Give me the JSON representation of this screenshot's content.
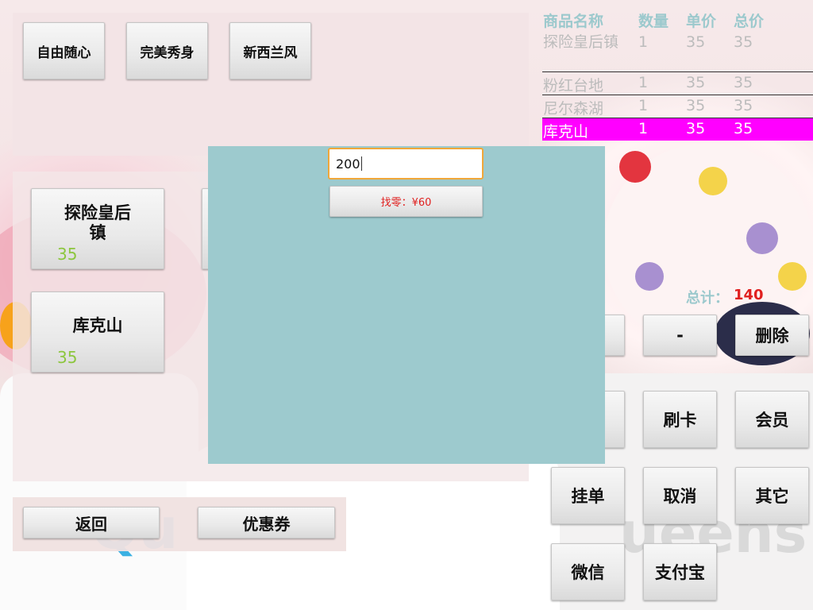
{
  "categories": [
    "自由随心",
    "完美秀身",
    "新西兰风"
  ],
  "products": [
    {
      "name": "探险皇后\n镇",
      "price": "35"
    },
    {
      "name": "库克山",
      "price": "35"
    }
  ],
  "bottom_buttons": {
    "back": "返回",
    "coupon": "优惠券"
  },
  "order": {
    "headers": {
      "name": "商品名称",
      "qty": "数量",
      "unit": "单价",
      "total": "总价"
    },
    "rows": [
      {
        "name": "探险皇后镇",
        "qty": "1",
        "unit": "35",
        "total": "35"
      },
      {
        "name": "粉红台地",
        "qty": "1",
        "unit": "35",
        "total": "35"
      },
      {
        "name": "尼尔森湖",
        "qty": "1",
        "unit": "35",
        "total": "35"
      },
      {
        "name": "库克山",
        "qty": "1",
        "unit": "35",
        "total": "35",
        "selected": true
      }
    ],
    "total_label": "总计：",
    "total_value": "140"
  },
  "actions": {
    "minus": "-",
    "delete": "删除",
    "card": "刷卡",
    "member": "会员",
    "hold": "挂单",
    "cancel": "取消",
    "other": "其它",
    "wechat": "微信",
    "alipay": "支付宝"
  },
  "dialog": {
    "cash_value": "200",
    "change_label": "找零：¥60"
  },
  "background": {
    "brand_left": "Qu",
    "brand_right": "ueens"
  },
  "colors": {
    "selected_row": "#ff00ff",
    "price_green": "#8cc63e",
    "total_red": "#e0201f",
    "header_teal": "#9cc9cd",
    "dialog_bg": "#9dcace",
    "input_border": "#f0a73a"
  }
}
